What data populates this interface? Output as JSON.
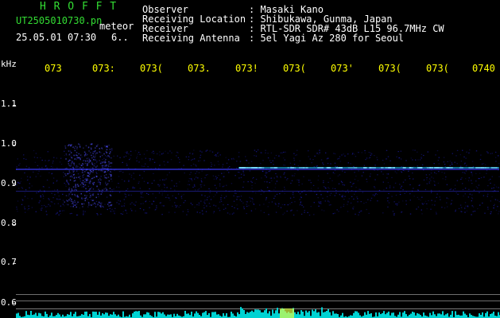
{
  "header": {
    "brand": "H R O F F T",
    "filename": "UT2505010730.pn",
    "tag": "meteor",
    "datetime": "25.05.01 07:30",
    "extra": "6.."
  },
  "info": [
    {
      "label": "Observer",
      "value": ": Masaki Kano"
    },
    {
      "label": "Receiving Location",
      "value": ": Shibukawa, Gunma, Japan"
    },
    {
      "label": "Receiver",
      "value": ": RTL-SDR SDR# 43dB L15 96.7MHz CW"
    },
    {
      "label": "Receiving Antenna",
      "value": ": 5el Yagi Az 280 for Seoul"
    }
  ],
  "axis": {
    "unit": "kHz",
    "time_ticks": [
      "073",
      "073:",
      "073(",
      "073.",
      "073!",
      "073(",
      "073'",
      "073(",
      "073(",
      "0740"
    ],
    "freq_ticks": [
      "1.1",
      "1.0",
      "0.9",
      "0.8",
      "0.7",
      "0.6"
    ]
  },
  "colors": {
    "text_green": "#33dd33",
    "text_white": "#ffffff",
    "text_yellow": "#ffff00",
    "background": "#000000",
    "noise": "#2a2aff",
    "signal": "#22ccff",
    "cyan_bottom": "#00dddd"
  }
}
